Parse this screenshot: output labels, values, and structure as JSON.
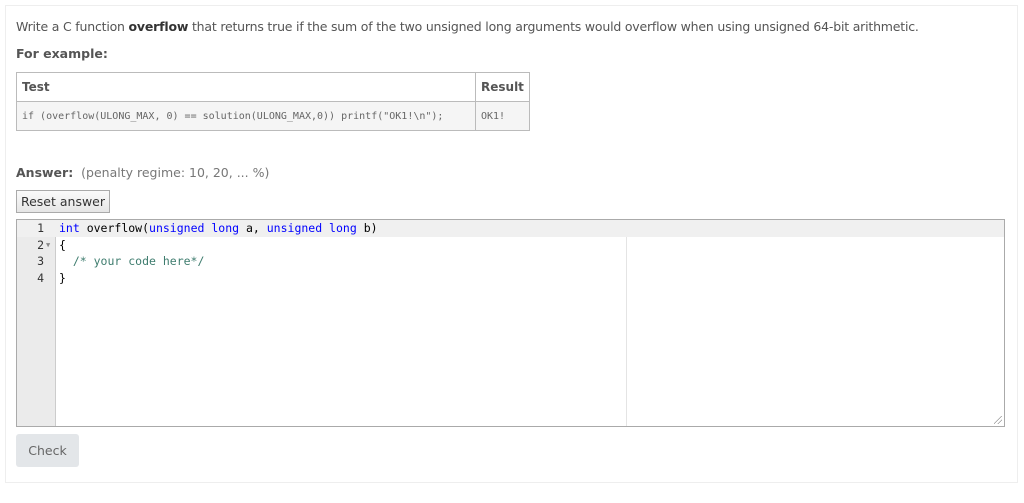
{
  "question": {
    "prefix": "Write a C function ",
    "bold": "overflow",
    "suffix": " that returns true if the sum of the two unsigned long arguments would overflow when using unsigned 64-bit arithmetic."
  },
  "for_example": "For example:",
  "table": {
    "headers": [
      "Test",
      "Result"
    ],
    "rows": [
      [
        "if (overflow(ULONG_MAX, 0) == solution(ULONG_MAX,0)) printf(\"OK1!\\n\");",
        "OK1!"
      ]
    ]
  },
  "answer": {
    "label": "Answer:",
    "penalty": "(penalty regime: 10, 20, ... %)"
  },
  "reset_label": "Reset answer",
  "editor": {
    "lines": [
      {
        "num": "1",
        "parts": [
          {
            "t": "int",
            "c": "kw"
          },
          {
            "t": " overflow(",
            "c": ""
          },
          {
            "t": "unsigned long",
            "c": "kw"
          },
          {
            "t": " a, ",
            "c": ""
          },
          {
            "t": "unsigned long",
            "c": "kw"
          },
          {
            "t": " b)",
            "c": ""
          }
        ]
      },
      {
        "num": "2",
        "parts": [
          {
            "t": "{",
            "c": ""
          }
        ]
      },
      {
        "num": "3",
        "parts": [
          {
            "t": "  /* your code here*/",
            "c": "cm"
          }
        ]
      },
      {
        "num": "4",
        "parts": [
          {
            "t": "}",
            "c": ""
          }
        ]
      }
    ]
  },
  "check_label": "Check"
}
